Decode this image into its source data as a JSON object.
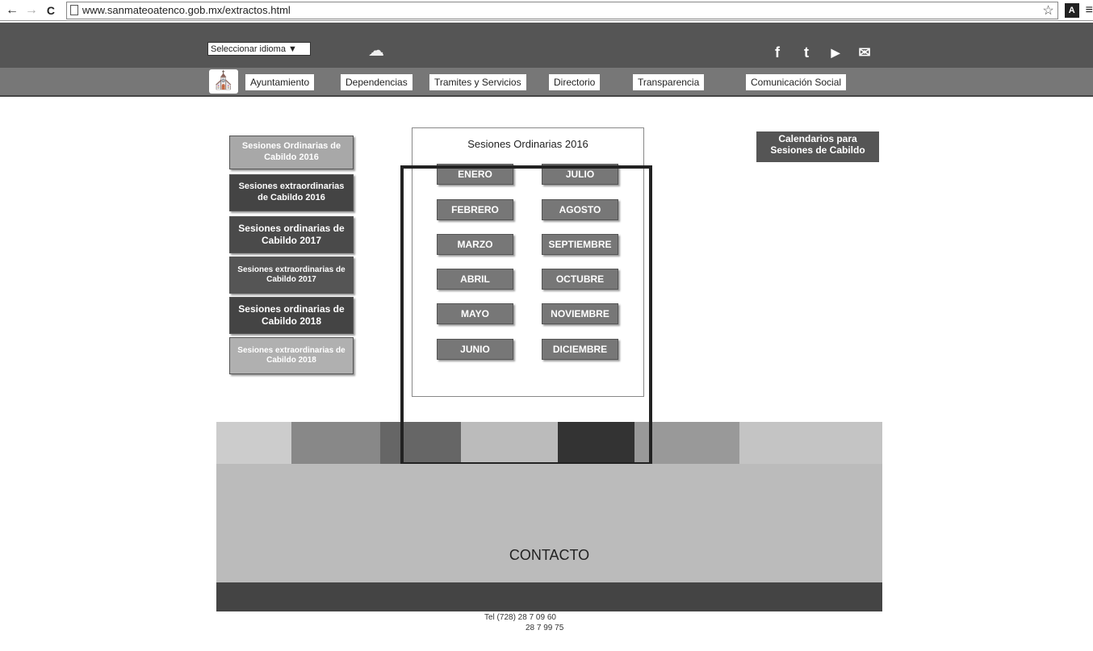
{
  "browser": {
    "back_icon": "←",
    "forward_icon": "→",
    "reload_icon": "C",
    "url": "www.sanmateoatenco.gob.mx/extractos.html",
    "star_icon": "☆",
    "extension_label": "A",
    "menu_icon": "≡"
  },
  "topbar": {
    "language_select": "Seleccionar idioma ▼",
    "cloud_icon": "☁",
    "social": [
      "f",
      "t",
      "▶",
      "✉"
    ]
  },
  "nav": {
    "items": [
      "Ayuntamiento",
      "Dependencias",
      "Tramites y Servicios",
      "Directorio",
      "Transparencia",
      "Comunicación Social"
    ]
  },
  "sidebar": {
    "items": [
      "Sesiones Ordinarias de Cabildo 2016",
      "Sesiones extraordinarias de Cabildo 2016",
      "Sesiones ordinarias de Cabildo 2017",
      "Sesiones extraordinarias de Cabildo 2017",
      "Sesiones ordinarias de Cabildo 2018",
      "Sesiones extraordinarias de Cabildo 2018"
    ]
  },
  "panel": {
    "title": "Sesiones Ordinarias 2016",
    "months_left": [
      "ENERO",
      "FEBRERO",
      "MARZO",
      "ABRIL",
      "MAYO",
      "JUNIO"
    ],
    "months_right": [
      "JULIO",
      "AGOSTO",
      "SEPTIEMBRE",
      "OCTUBRE",
      "NOVIEMBRE",
      "DICIEMBRE"
    ]
  },
  "calendar_button": "Calendarios para Sesiones de Cabildo",
  "footer": {
    "contact_title": "CONTACTO",
    "tel_line_1": "Tel (728) 28 7 09 60",
    "tel_line_2": "28 7 99 75"
  },
  "colors": {
    "topbar": "#555555",
    "navbar": "#777777",
    "side_dark": "#444444",
    "side_light": "#a8a8a8"
  }
}
